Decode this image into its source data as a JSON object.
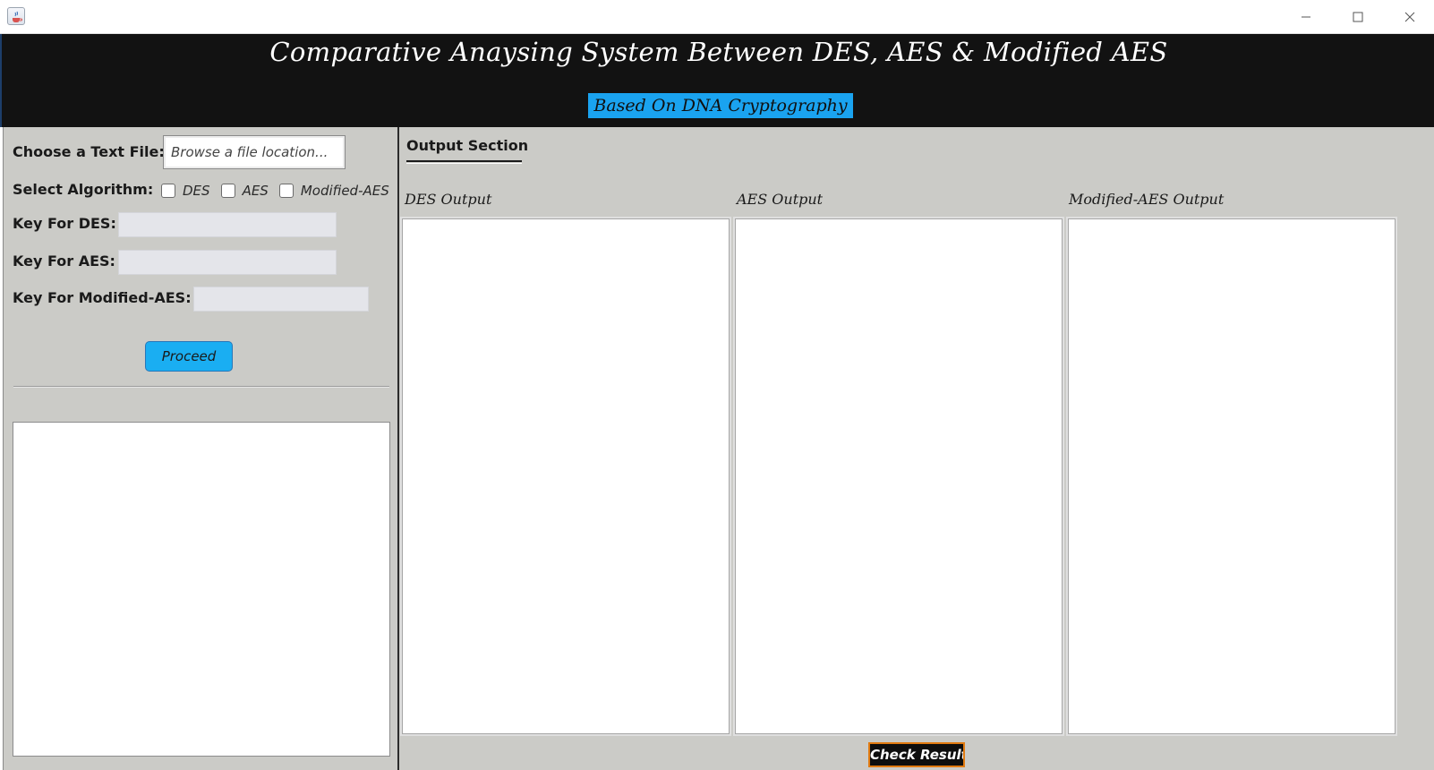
{
  "header": {
    "title": "Comparative Anaysing System Between DES, AES & Modified AES",
    "subtitle": "Based On DNA Cryptography"
  },
  "input_panel": {
    "file_label": "Choose a Text File:",
    "file_placeholder": "Browse a file location...",
    "algorithm_label": "Select Algorithm:",
    "algorithms": [
      {
        "label": "DES",
        "checked": false
      },
      {
        "label": "AES",
        "checked": false
      },
      {
        "label": "Modified-AES",
        "checked": false
      }
    ],
    "key_des_label": "Key For DES:",
    "key_des_value": "",
    "key_aes_label": "Key For AES:",
    "key_aes_value": "",
    "key_maes_label": "Key For Modified-AES:",
    "key_maes_value": "",
    "proceed_label": "Proceed",
    "log_text": ""
  },
  "output_panel": {
    "title": "Output Section",
    "columns": [
      {
        "label": "DES Output",
        "content": ""
      },
      {
        "label": "AES Output",
        "content": ""
      },
      {
        "label": "Modified-AES Output",
        "content": ""
      }
    ],
    "check_result_label": "Check Result"
  },
  "colors": {
    "header_bg": "#121212",
    "subtitle_bg": "#1aa3f0",
    "panel_bg": "#cbcbc7",
    "proceed_bg": "#1aaef2",
    "check_result_border": "#e07a10"
  },
  "icons": {
    "app": "java-cup-icon",
    "minimize": "minimize-icon",
    "maximize": "maximize-icon",
    "close": "close-icon"
  }
}
